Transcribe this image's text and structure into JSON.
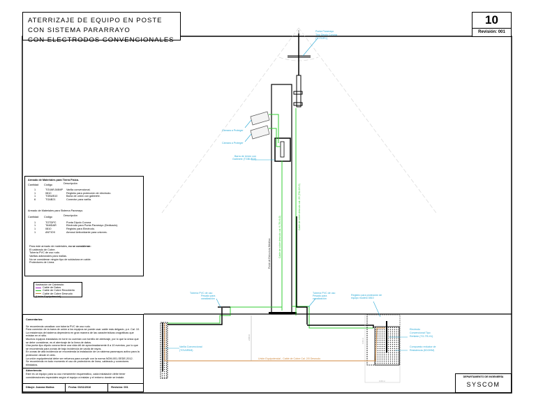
{
  "title": {
    "line1": "ATERRIZAJE DE EQUIPO EN POSTE CON SISTEMA PARARRAYO",
    "line2": "CON ELECTRODOS CONVENCIONALES"
  },
  "sheet": {
    "number": "10",
    "revision": "Revisión: 001"
  },
  "labels": {
    "punta_1": "Punta Pararrayo",
    "punta_2": "Tipo Dipolo Corona",
    "punta_3": "(TOTDPC)",
    "camara_1": "Cámara a Proteger",
    "camara_2": "Cámara a Proteger",
    "barra_1": "Barra de Unión con",
    "barra_2": "Gabinete (TGBUB10)",
    "cable_pararrayo": "Cable de cobre desnudo cal. 2/0 (TIU-2/0-D)",
    "cable_equipo": "Cable de cobre desnudo cal. 6 (TIU-6-D)",
    "poste": "Poste de Estructura Metálica",
    "tuberia_left_1": "Tubería PVC de uso",
    "tuberia_left_2": "Pesado para",
    "tuberia_left_3": "canalización",
    "tuberia_right_1": "Tubería PVC de uso",
    "tuberia_right_2": "Pesado para",
    "tuberia_right_3": "canalización",
    "registro_1": "Registro para protección de",
    "registro_2": "equipo modelo 0810",
    "varilla_1": "Varilla Convencional",
    "varilla_2": "(TGVAR5/8)",
    "union": "Unión Equipotencial - Cable de Cobre Cal. 2/0 Desnudo",
    "electrodo_1": "Electrodo",
    "electrodo_2": "Convencional Tipo",
    "electrodo_3": "Rehilete (TG-TR-H1)",
    "compuesto_1": "Compuesto reductor de",
    "compuesto_2": "Resistencia (KDOHM)",
    "dim_depth": "2.00 m",
    "dim_width": "0.60 m",
    "dim_pit": "0.80 m"
  },
  "materials_tierra": {
    "title": "Armado de Materiales para Tierra Física.",
    "headers": [
      "Cantidad",
      "Código",
      "Descripción"
    ],
    "rows": [
      [
        "1",
        "TGVAR-5/8MP",
        "Varilla convencional."
      ],
      [
        "1",
        "0810",
        "Registro para protección de electrodo."
      ],
      [
        "1",
        "TGBUB10",
        "Barra de unión con gabinete."
      ],
      [
        "6",
        "TGAB21",
        "Conector para varilla."
      ]
    ]
  },
  "materials_pararrayo": {
    "title": "Armado de Materiales para Sistema Pararrayo.",
    "headers": [
      "Cantidad",
      "Código",
      "Descripción"
    ],
    "rows": [
      [
        "1",
        "TOTDPC",
        "Punta Dipolo Corona"
      ],
      [
        "1",
        "TAMDAR",
        "Electrodo para Punta Pararrayo (Dedicado)."
      ],
      [
        "1",
        "0810",
        "Registro para Electrodo."
      ],
      [
        "1",
        "ANTIOX",
        "Aerosol Antioxidante para uniones."
      ]
    ]
  },
  "not_considered": {
    "intro": "Para este armado de materiales, ",
    "intro_bold": "no se consideran:",
    "items": [
      "El cableado de Cobre.",
      "Tubería PVC de uso rudo.",
      "Varillas adicionales para mallas.",
      "No se consideran ningún tipo de soldadura en cable.",
      "Protectores de Línea."
    ]
  },
  "legend": {
    "title": "Ilustración de Cableado:",
    "items": [
      {
        "label": "Cable de Datos",
        "color": "#a020c0"
      },
      {
        "label": "Cable de Cobre Recubierto",
        "color": "#20c020"
      },
      {
        "label": "Cable de Cobre Desnudo (Unión Equipotencial)",
        "color": "#c08040"
      }
    ]
  },
  "comments": {
    "title": "Comentarios:",
    "lines": [
      "Se recomienda canalizar con tubería PVC de uso rudo.",
      "Para conexión de la barra de unión a los equipos se puede usar cable más delgado, p.e. Cal. 10.",
      "La resistencia del sistema dependerá en gran manera de las características orográficas que existan en el sitio.",
      "Muchos equipos instalados en torre no cuentan con tornillo de aterrizaje, por lo que la única que se debe considerar, es el aterrizaje de la línea de datos.",
      "Una punta tipo dipolo corona tiene una vida útil de aproximadamente 8 a 10 eventos, por lo que se recomienda para zonas de bajo incidencia de caída de rayos.",
      "En zonas de alta incidencia se recomienda la instalación de un sistema pararrayos activo para la protección desde el cielo.",
      "La unión equipotencial debe ser refuerza para cumplir con la norma NOM-001-SEDE-2012.",
      "Se recomienda en todo momento el uso de protectores de línea, cableado y conectores blindados."
    ],
    "warning_title": "Advertencia:",
    "warning": "Este es un equipo para su uso meramente esquemático, cada instalación debe tener consideraciones especiales según el equipo a instalar y el entorno donde se instale."
  },
  "footer": {
    "drawn_by": "Dibujó: Joanna Molina",
    "date": "Fecha: 03/11/2016",
    "revision": "Revisión: 001"
  },
  "department": {
    "label": "DEPARTAMENTO DE INGENIERÍA",
    "company": "SYSCOM"
  },
  "colors": {
    "green": "#33cc33",
    "cyan": "#29a9d6",
    "orange": "#d08a40",
    "guide": "#c8c8c8"
  }
}
